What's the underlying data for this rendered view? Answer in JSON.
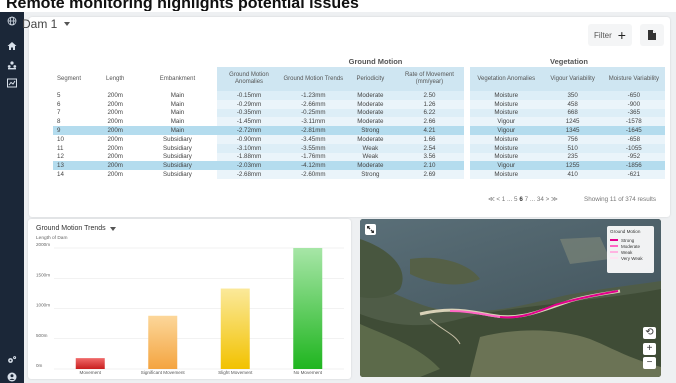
{
  "headline": "Remote monitoring highlights potential issues",
  "sidebar": {
    "top_icon": "globe-logo-icon",
    "items": [
      {
        "name": "home-icon"
      },
      {
        "name": "sites-icon"
      },
      {
        "name": "chart-icon"
      }
    ],
    "bottom": [
      {
        "name": "settings-icon"
      },
      {
        "name": "user-icon"
      }
    ]
  },
  "header": {
    "title": "Dam 1",
    "filter_label": "Filter",
    "filter_icon": "+",
    "export_icon": "document-icon"
  },
  "table": {
    "group_ground_motion": "Ground Motion",
    "group_vegetation": "Vegetation",
    "columns": [
      "Segment",
      "Length",
      "Embankment",
      "Ground Motion Anomalies",
      "Ground Motion Trends",
      "Periodicity",
      "Rate of Movement (mm/year)",
      "Vegetation Anomalies",
      "Vigour Variability",
      "Moisture Variability"
    ],
    "rows": [
      {
        "segment": "5",
        "length": "200m",
        "embankment": "Main",
        "gm_anom": "-0.15mm",
        "gm_trend": "-1.23mm",
        "periodicity": "Moderate",
        "rate": "2.50",
        "veg_anom": "Moisture",
        "vigour": "350",
        "moisture": "-650"
      },
      {
        "segment": "6",
        "length": "200m",
        "embankment": "Main",
        "gm_anom": "-0.29mm",
        "gm_trend": "-2.66mm",
        "periodicity": "Moderate",
        "rate": "1.26",
        "veg_anom": "Moisture",
        "vigour": "458",
        "moisture": "-900"
      },
      {
        "segment": "7",
        "length": "200m",
        "embankment": "Main",
        "gm_anom": "-0.35mm",
        "gm_trend": "-0.25mm",
        "periodicity": "Moderate",
        "rate": "6.22",
        "veg_anom": "Moisture",
        "vigour": "668",
        "moisture": "-365"
      },
      {
        "segment": "8",
        "length": "200m",
        "embankment": "Main",
        "gm_anom": "-1.45mm",
        "gm_trend": "-3.11mm",
        "periodicity": "Moderate",
        "rate": "2.66",
        "veg_anom": "Vigour",
        "vigour": "1245",
        "moisture": "-1578"
      },
      {
        "segment": "9",
        "length": "200m",
        "embankment": "Main",
        "gm_anom": "-2.72mm",
        "gm_trend": "-2.81mm",
        "periodicity": "Strong",
        "rate": "4.21",
        "veg_anom": "Vigour",
        "vigour": "1345",
        "moisture": "-1645"
      },
      {
        "segment": "10",
        "length": "200m",
        "embankment": "Subsidiary",
        "gm_anom": "-0.90mm",
        "gm_trend": "-3.45mm",
        "periodicity": "Moderate",
        "rate": "1.66",
        "veg_anom": "Moisture",
        "vigour": "756",
        "moisture": "-658"
      },
      {
        "segment": "11",
        "length": "200m",
        "embankment": "Subsidiary",
        "gm_anom": "-3.10mm",
        "gm_trend": "-3.55mm",
        "periodicity": "Weak",
        "rate": "2.54",
        "veg_anom": "Moisture",
        "vigour": "510",
        "moisture": "-1055"
      },
      {
        "segment": "12",
        "length": "200m",
        "embankment": "Subsidiary",
        "gm_anom": "-1.88mm",
        "gm_trend": "-1.76mm",
        "periodicity": "Weak",
        "rate": "3.56",
        "veg_anom": "Moisture",
        "vigour": "235",
        "moisture": "-952"
      },
      {
        "segment": "13",
        "length": "200m",
        "embankment": "Subsidiary",
        "gm_anom": "-2.03mm",
        "gm_trend": "-4.12mm",
        "periodicity": "Moderate",
        "rate": "2.10",
        "veg_anom": "Vigour",
        "vigour": "1255",
        "moisture": "-1856"
      },
      {
        "segment": "14",
        "length": "200m",
        "embankment": "Subsidiary",
        "gm_anom": "-2.68mm",
        "gm_trend": "-2.60mm",
        "periodicity": "Strong",
        "rate": "2.69",
        "veg_anom": "Moisture",
        "vigour": "410",
        "moisture": "-621"
      }
    ],
    "highlighted_rows": [
      "9",
      "13"
    ],
    "pager": {
      "first": "≪",
      "prev": "<",
      "p1": "1",
      "ellipsis1": "...",
      "p5": "5",
      "p6": "6",
      "p7": "7",
      "ellipsis2": "...",
      "p34": "34",
      "next": ">",
      "last": "≫"
    },
    "showing": "Showing 11 of 374 results"
  },
  "chart_data": {
    "type": "bar",
    "title": "Ground Motion Trends",
    "ylabel": "Length of Dam",
    "categories": [
      "Movement",
      "Significant Movement",
      "Slight Movement",
      "No Movement"
    ],
    "values": [
      180,
      880,
      1330,
      2000
    ],
    "ylim": [
      0,
      2000
    ],
    "yticks": [
      {
        "label": "2000m",
        "value": 2000
      },
      {
        "label": "1500m",
        "value": 1500
      },
      {
        "label": "1000m",
        "value": 1000
      },
      {
        "label": "500m",
        "value": 500
      },
      {
        "label": "0m",
        "value": 0
      }
    ],
    "colors": [
      [
        "#c81e1e",
        "#f06a6a"
      ],
      [
        "#f4a440",
        "#fcd79a"
      ],
      [
        "#f2c200",
        "#fbe99a"
      ],
      [
        "#1fb51f",
        "#a7e6a7"
      ]
    ],
    "grid": true
  },
  "map": {
    "legend_title": "Ground Motion",
    "legend": [
      {
        "label": "Strong",
        "color": "#e3008c"
      },
      {
        "label": "Moderate",
        "color": "#ff66c4"
      },
      {
        "label": "Weak",
        "color": "#ffb3e1"
      },
      {
        "label": "Very Weak",
        "color": "#ffe3f3"
      }
    ],
    "controls": [
      "⟲",
      "+",
      "−"
    ],
    "expand_icon": "expand-icon"
  }
}
